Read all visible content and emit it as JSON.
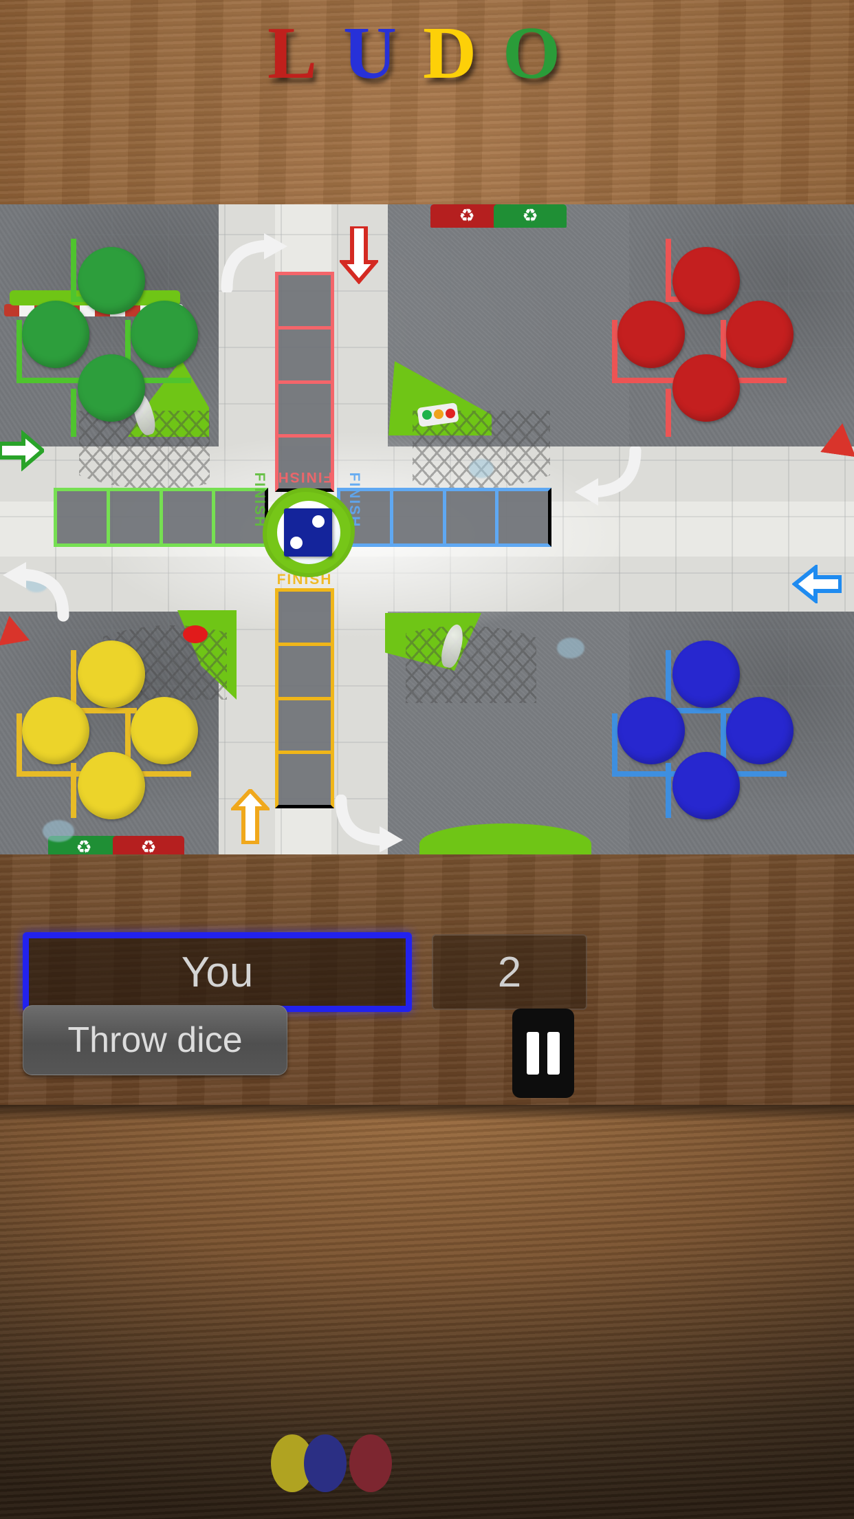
{
  "app": {
    "title_letters": [
      {
        "char": "L",
        "color": "#c0201c"
      },
      {
        "char": "U",
        "color": "#2731d8"
      },
      {
        "char": "D",
        "color": "#fdd008"
      },
      {
        "char": "O",
        "color": "#2a9c39"
      }
    ],
    "title_text": "LUDO"
  },
  "board": {
    "dice": {
      "value": 2,
      "face_color": "#14249b",
      "pip_color": "#ffffff"
    },
    "center_label": "",
    "finish_labels": {
      "red": "FINISH",
      "green": "FINISH",
      "blue": "FINISH",
      "yellow": "FINISH"
    },
    "players": [
      {
        "name": "green",
        "color": "#2a9c39",
        "home_tokens": 4,
        "corner": "top-left",
        "direction_arrow": "arrow-right"
      },
      {
        "name": "red",
        "color": "#c41f1f",
        "home_tokens": 4,
        "corner": "top-right",
        "direction_arrow": "arrow-down"
      },
      {
        "name": "yellow",
        "color": "#ecd42a",
        "home_tokens": 4,
        "corner": "bottom-left",
        "direction_arrow": "arrow-up"
      },
      {
        "name": "blue",
        "color": "#2727cf",
        "home_tokens": 4,
        "corner": "bottom-right",
        "direction_arrow": "arrow-left"
      }
    ],
    "lane_colors": {
      "red": "#f4656a",
      "yellow": "#f0b619",
      "green": "#76df52",
      "blue": "#5fa8f2"
    },
    "decor": {
      "bins": [
        {
          "color": "#b51f1f",
          "icon": "recycle-icon",
          "position": "top-right-area"
        },
        {
          "color": "#1f8f35",
          "icon": "recycle-icon",
          "position": "top-right-area"
        },
        {
          "color": "#1f8f35",
          "icon": "recycle-icon",
          "position": "bottom-left-area"
        },
        {
          "color": "#b51f1f",
          "icon": "recycle-icon",
          "position": "bottom-left-area"
        }
      ],
      "recycle_glyph": "♻"
    }
  },
  "hud": {
    "current_player_label": "You",
    "dice_value_label": "2",
    "throw_button_label": "Throw dice",
    "seat_colors": [
      "#b0a321",
      "#2b2f84",
      "#7d2630"
    ],
    "pause_icon": "pause-icon",
    "active_player_border_color": "#2222ee"
  }
}
